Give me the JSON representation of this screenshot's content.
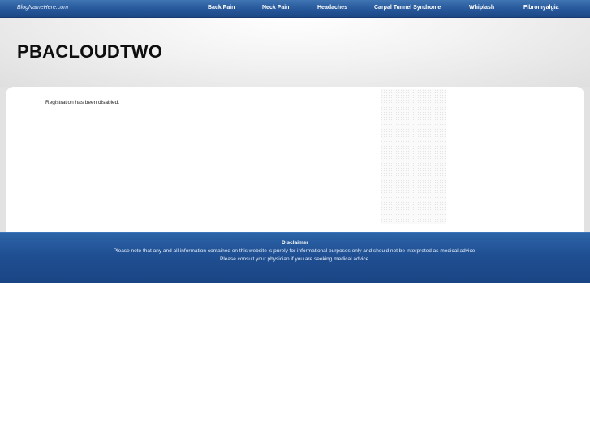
{
  "topbar": {
    "blog_name": "BlogNameHere.com",
    "nav": [
      {
        "label": "Back Pain"
      },
      {
        "label": "Neck Pain"
      },
      {
        "label": "Headaches"
      },
      {
        "label": "Carpal Tunnel Syndrome"
      },
      {
        "label": "Whiplash"
      },
      {
        "label": "Fibromyalgia"
      }
    ]
  },
  "header": {
    "site_title": "PBACLOUDTWO"
  },
  "main": {
    "message": "Registration has been disabled."
  },
  "footer": {
    "title": "Disclaimer",
    "line1": "Please note that any and all information contained on this website is purely for informational purposes only and should not be interpreted as medical advice.",
    "line2": "Please consult your physician if you are seeking medical advice."
  },
  "colors": {
    "topbar_blue": "#26579a",
    "footer_blue": "#1f4f92",
    "header_gray": "#dedede"
  }
}
